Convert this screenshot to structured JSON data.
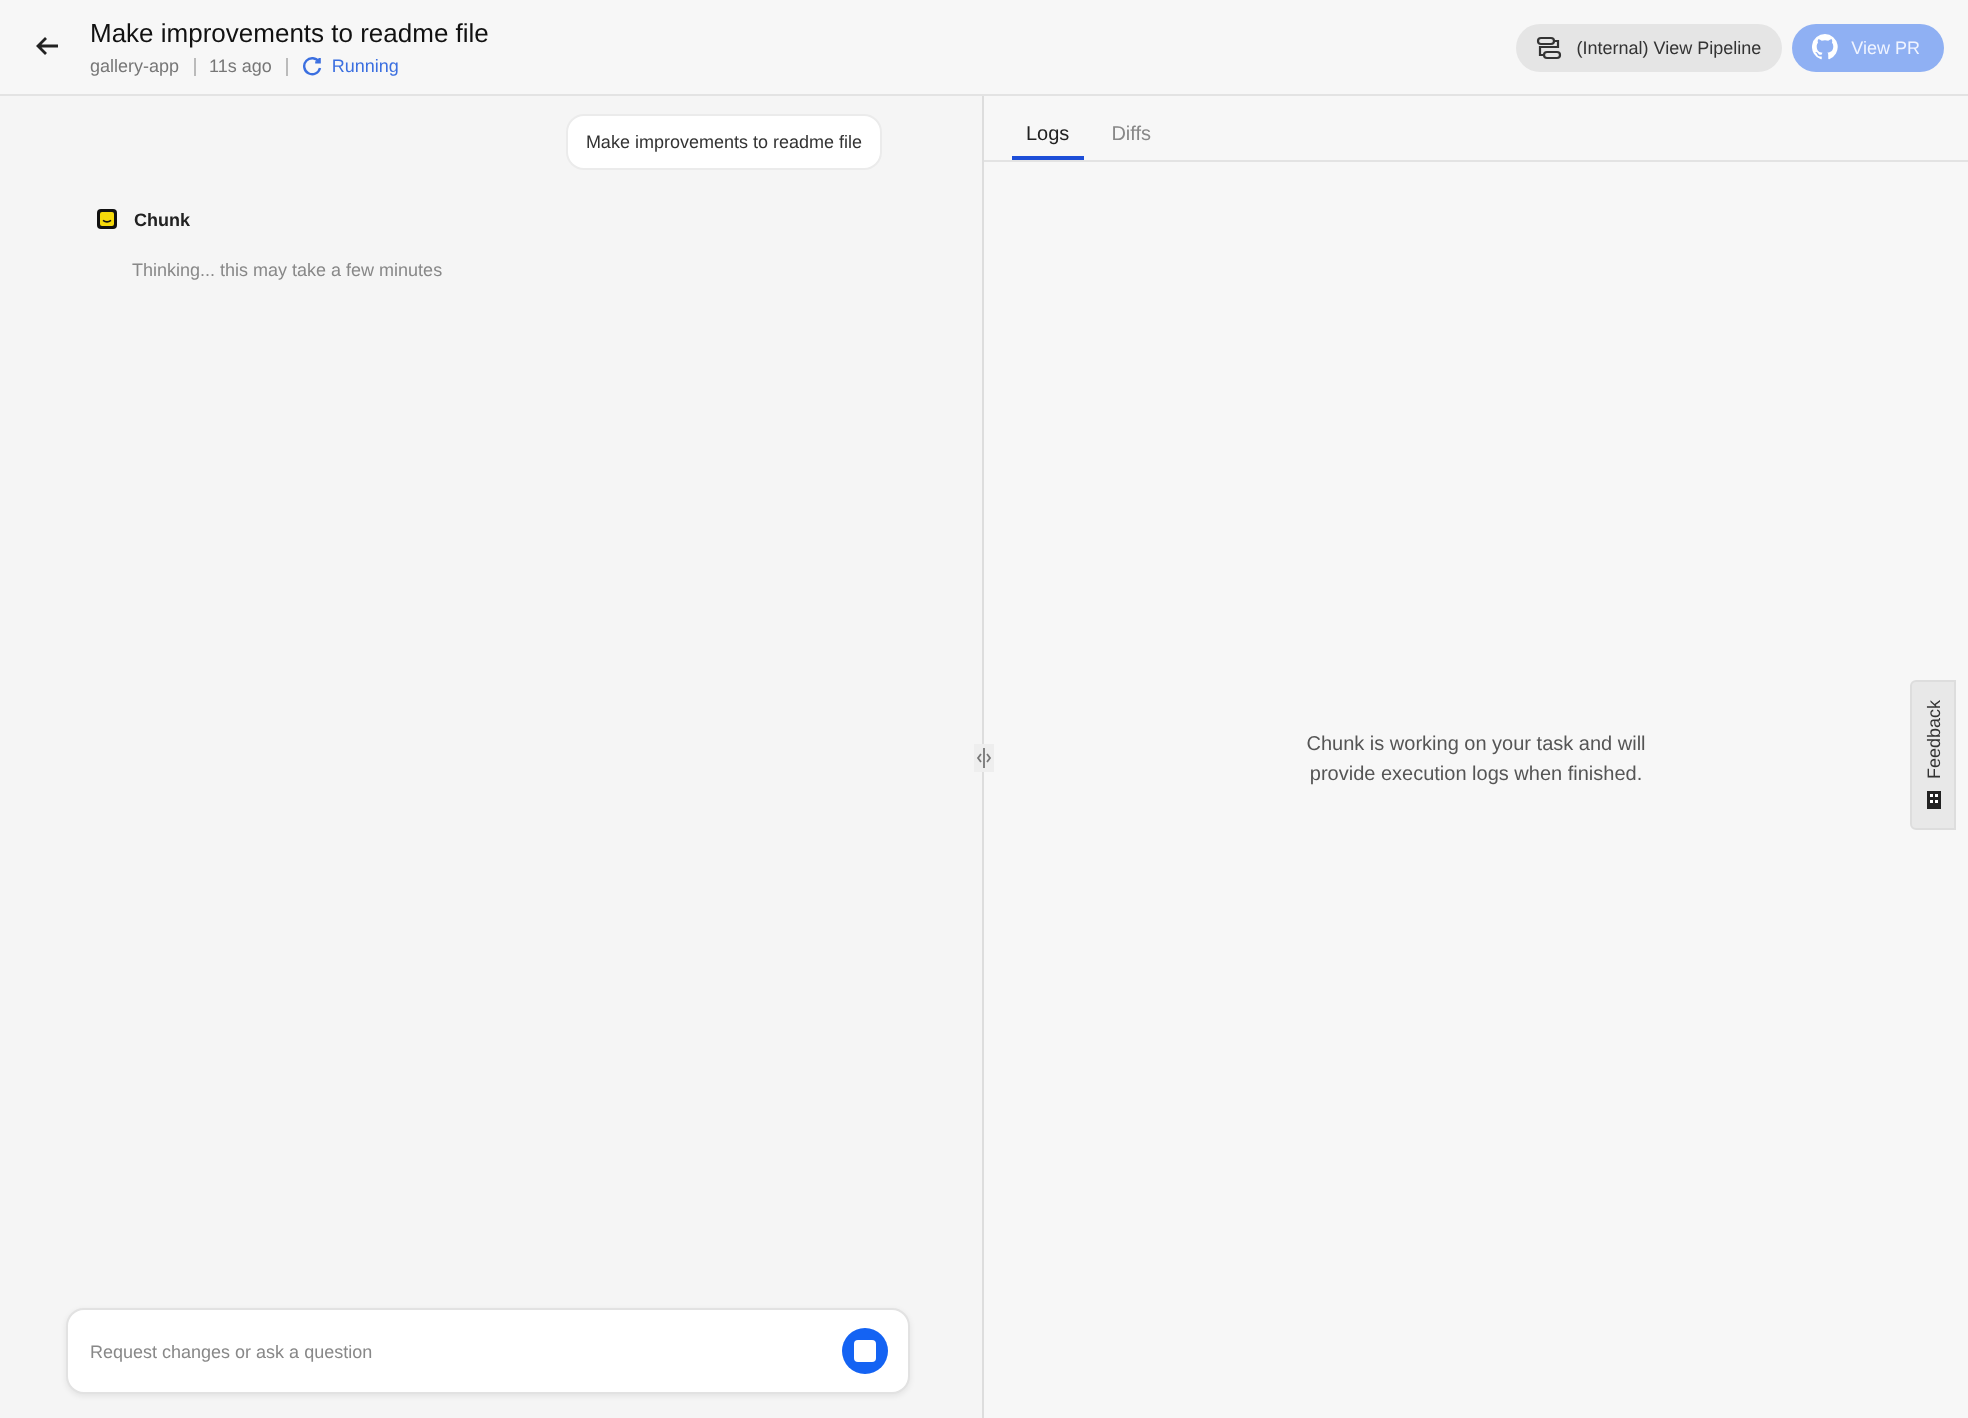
{
  "header": {
    "title": "Make improvements to readme file",
    "repo": "gallery-app",
    "time": "11s ago",
    "status": "Running"
  },
  "header_buttons": [
    {
      "label": "(Internal) View Pipeline",
      "kind": "pipeline",
      "disabled": false
    },
    {
      "label": "View PR",
      "kind": "github",
      "disabled": true
    }
  ],
  "chat": {
    "user_message": "Make improvements to readme file",
    "agent_name": "Chunk",
    "agent_status": "Thinking... this may take a few minutes"
  },
  "composer": {
    "placeholder": "Request changes or ask a question"
  },
  "tabs": [
    {
      "label": "Logs",
      "selected": true
    },
    {
      "label": "Diffs",
      "selected": false
    }
  ],
  "logs_message": "Chunk is working on your task and will provide execution logs when finished.",
  "feedback": {
    "label": "Feedback"
  }
}
